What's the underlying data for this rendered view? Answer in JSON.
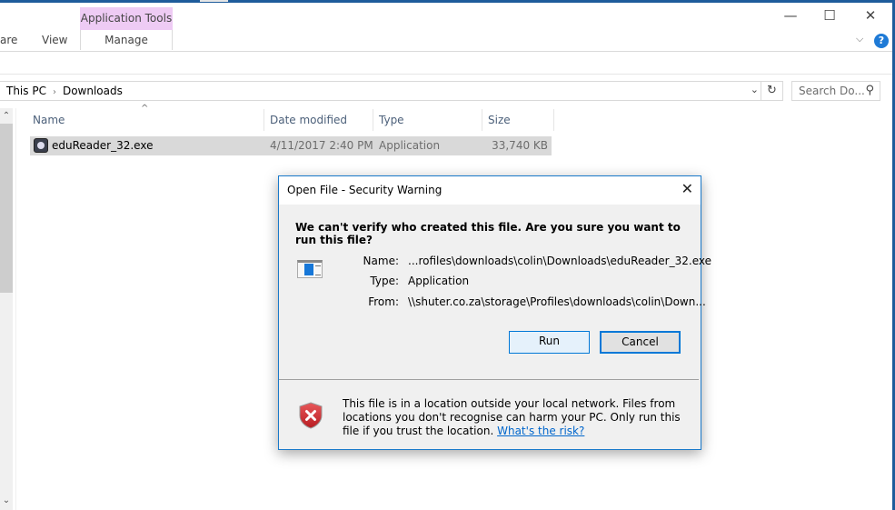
{
  "ribbon": {
    "context_tab": "Application Tools",
    "tabs": [
      "are",
      "View"
    ],
    "manage": "Manage"
  },
  "window_controls": {
    "minimize": "—",
    "maximize": "☐",
    "close": "✕",
    "expand": "⌵",
    "help": "?"
  },
  "address": {
    "crumbs": [
      "This PC",
      "Downloads"
    ],
    "separator": "›",
    "dropdown": "⌄",
    "refresh": "↻"
  },
  "search": {
    "placeholder": "Search Do...",
    "icon": "⚲"
  },
  "scroll": {
    "up": "⌃",
    "down": "⌄"
  },
  "columns": {
    "name": "Name",
    "date": "Date modified",
    "type": "Type",
    "size": "Size",
    "sort_indicator": "^"
  },
  "files": [
    {
      "name": "eduReader_32.exe",
      "date": "4/11/2017 2:40 PM",
      "type": "Application",
      "size": "33,740 KB"
    }
  ],
  "dialog": {
    "title": "Open File - Security Warning",
    "close": "✕",
    "heading": "We can't verify who created this file. Are you sure you want to run this file?",
    "name_label": "Name:",
    "name_value": "...rofiles\\downloads\\colin\\Downloads\\eduReader_32.exe",
    "type_label": "Type:",
    "type_value": "Application",
    "from_label": "From:",
    "from_value": "\\\\shuter.co.za\\storage\\Profiles\\downloads\\colin\\Down...",
    "run": "Run",
    "cancel": "Cancel",
    "warning": "This file is in a location outside your local network. Files from locations you don't recognise can harm your PC. Only run this file if you trust the location.",
    "risk_link": "What's the risk?"
  }
}
